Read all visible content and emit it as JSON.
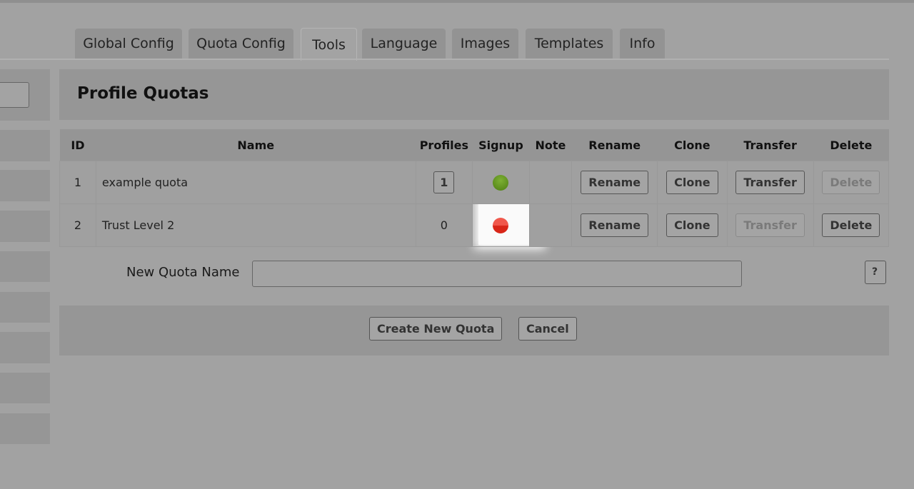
{
  "tabs": [
    {
      "label": "Global Config"
    },
    {
      "label": "Quota Config"
    },
    {
      "label": "Tools"
    },
    {
      "label": "Language"
    },
    {
      "label": "Images"
    },
    {
      "label": "Templates"
    },
    {
      "label": "Info"
    }
  ],
  "panel": {
    "title": "Profile Quotas"
  },
  "table": {
    "headers": [
      "ID",
      "Name",
      "Profiles",
      "Signup",
      "Note",
      "Rename",
      "Clone",
      "Transfer",
      "Delete"
    ],
    "rows": [
      {
        "id": "1",
        "name": "example quota",
        "profiles": "1",
        "signup": "enabled",
        "signup_color": "#5a8a1a",
        "note": "",
        "rename": "Rename",
        "clone": "Clone",
        "transfer": "Transfer",
        "delete": "Delete"
      },
      {
        "id": "2",
        "name": "Trust Level 2",
        "profiles": "0",
        "signup": "disabled",
        "signup_color": "#e0281c",
        "note": "",
        "rename": "Rename",
        "clone": "Clone",
        "transfer": "Transfer",
        "delete": "Delete"
      }
    ]
  },
  "form": {
    "new_quota_label": "New Quota Name",
    "new_quota_value": "",
    "help": "?",
    "create": "Create New Quota",
    "cancel": "Cancel"
  }
}
